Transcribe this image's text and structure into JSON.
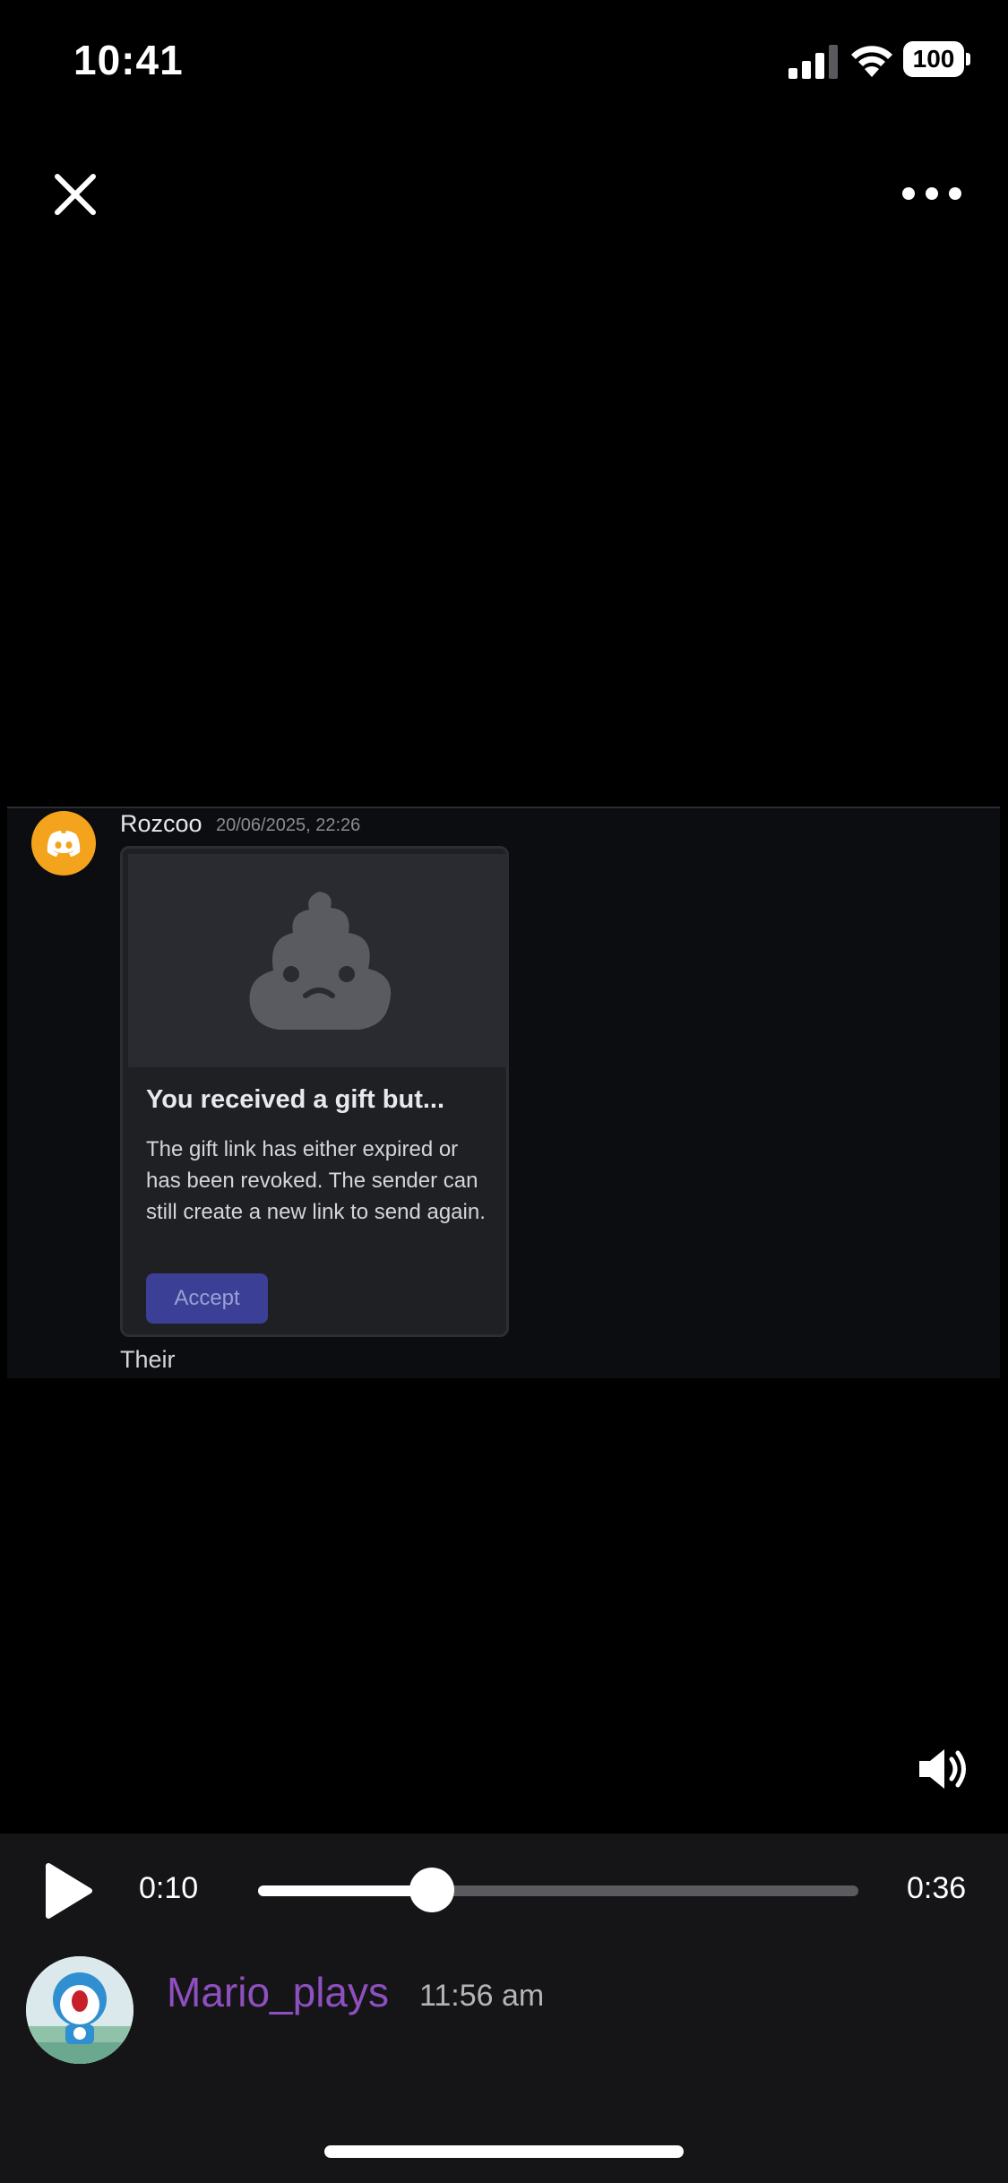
{
  "status_bar": {
    "time": "10:41",
    "battery_level": "100",
    "icons": [
      "signal-icon",
      "wifi-icon",
      "battery-icon"
    ]
  },
  "top_nav": {
    "close_icon": "close-icon",
    "more_icon": "more-icon"
  },
  "media": {
    "message": {
      "username": "Rozcoo",
      "timestamp": "20/06/2025, 22:26",
      "avatar_icon": "discord-logo-icon",
      "avatar_color": "#f4a31c",
      "gift_card": {
        "image_icon": "poop-emoji-icon",
        "title": "You received a gift but...",
        "description": "The gift link has either expired or has been revoked. The sender can still create a new link to send again.",
        "button_label": "Accept",
        "button_color": "#3c3f96"
      },
      "text": "Their"
    }
  },
  "player": {
    "volume_icon": "speaker-icon",
    "play_icon": "play-icon",
    "current_time": "0:10",
    "total_time": "0:36",
    "progress": 0.29
  },
  "post": {
    "author": "Mario_plays",
    "author_color": "#8e4fbf",
    "time": "11:56 am",
    "avatar_icon": "user-avatar-icon"
  }
}
